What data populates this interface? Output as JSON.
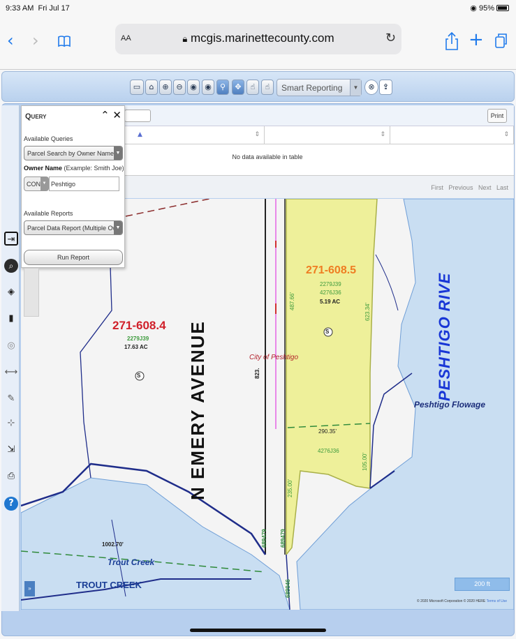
{
  "status_bar": {
    "time": "9:33 AM",
    "date": "Fri Jul 17",
    "battery": "95%"
  },
  "browser": {
    "aa_label": "AA",
    "url": "mcgis.marinettecounty.com",
    "icons": [
      "back-chevron-icon",
      "forward-chevron-icon",
      "bookmarks-icon",
      "lock-icon",
      "reload-icon",
      "share-icon",
      "add-tab-icon",
      "tabs-icon"
    ]
  },
  "toolbar": {
    "smart_reporting": "Smart Reporting",
    "tools": [
      "monitor-icon",
      "home-icon",
      "zoom-in-icon",
      "zoom-out-icon",
      "zoom-next-icon",
      "zoom-prev-icon",
      "identify-icon",
      "pan-icon",
      "select-icon",
      "select-polygon-icon"
    ]
  },
  "query_panel": {
    "title": "Query",
    "available_queries_label": "Available Queries",
    "query_selected": "Parcel Search by Owner Name (Mult",
    "owner_name_label": "Owner Name",
    "owner_name_hint": "(Example: Smith Joe)",
    "owner_operator": "CON",
    "owner_value": "Peshtigo",
    "available_reports_label": "Available Reports",
    "report_selected": "Parcel Data Report (Multiple Owner)",
    "run_button": "Run Report"
  },
  "results_table": {
    "print_label": "Print",
    "no_data": "No data available in table",
    "pager": [
      "First",
      "Previous",
      "Next",
      "Last"
    ]
  },
  "map": {
    "parcels": [
      {
        "id": "271-608.4",
        "codes": [
          "2279J39"
        ],
        "area": "17.63 AC",
        "marker": "S"
      },
      {
        "id": "271-608.5",
        "codes": [
          "2279J39",
          "4276J36"
        ],
        "area": "5.19 AC",
        "marker": "S"
      }
    ],
    "streets": [
      "N EMERY AVENUE"
    ],
    "water_labels": [
      "PESHTIGO RIVE",
      "Peshtigo Flowage",
      "Trout Creek",
      "TROUT CREEK"
    ],
    "city_label": "City of Peshtigo",
    "dimensions": [
      "487.66'",
      "623.34'",
      "290.35'",
      "4276J36",
      "235.00'",
      "105.00'",
      "823.",
      "1002.70'",
      "689479",
      "689479",
      "689946"
    ],
    "scale_label": "200 ft",
    "attribution": "© 2020 Microsoft Corporation © 2020 HERE",
    "terms_link": "Terms of Use",
    "colors": {
      "water": "#c9def2",
      "selected_parcel": "#eef09a",
      "parcel_line": "#1f2d8a",
      "label_red": "#d0202a",
      "label_orange": "#ef7d22",
      "label_green": "#3c9a3c",
      "river_text": "#1836d6"
    }
  },
  "left_rail_icons": [
    "login-icon",
    "search-icon",
    "layers-icon",
    "legend-icon",
    "target-icon",
    "measure-icon",
    "draw-icon",
    "crosshair-icon",
    "export-icon",
    "print-icon",
    "help-icon"
  ]
}
